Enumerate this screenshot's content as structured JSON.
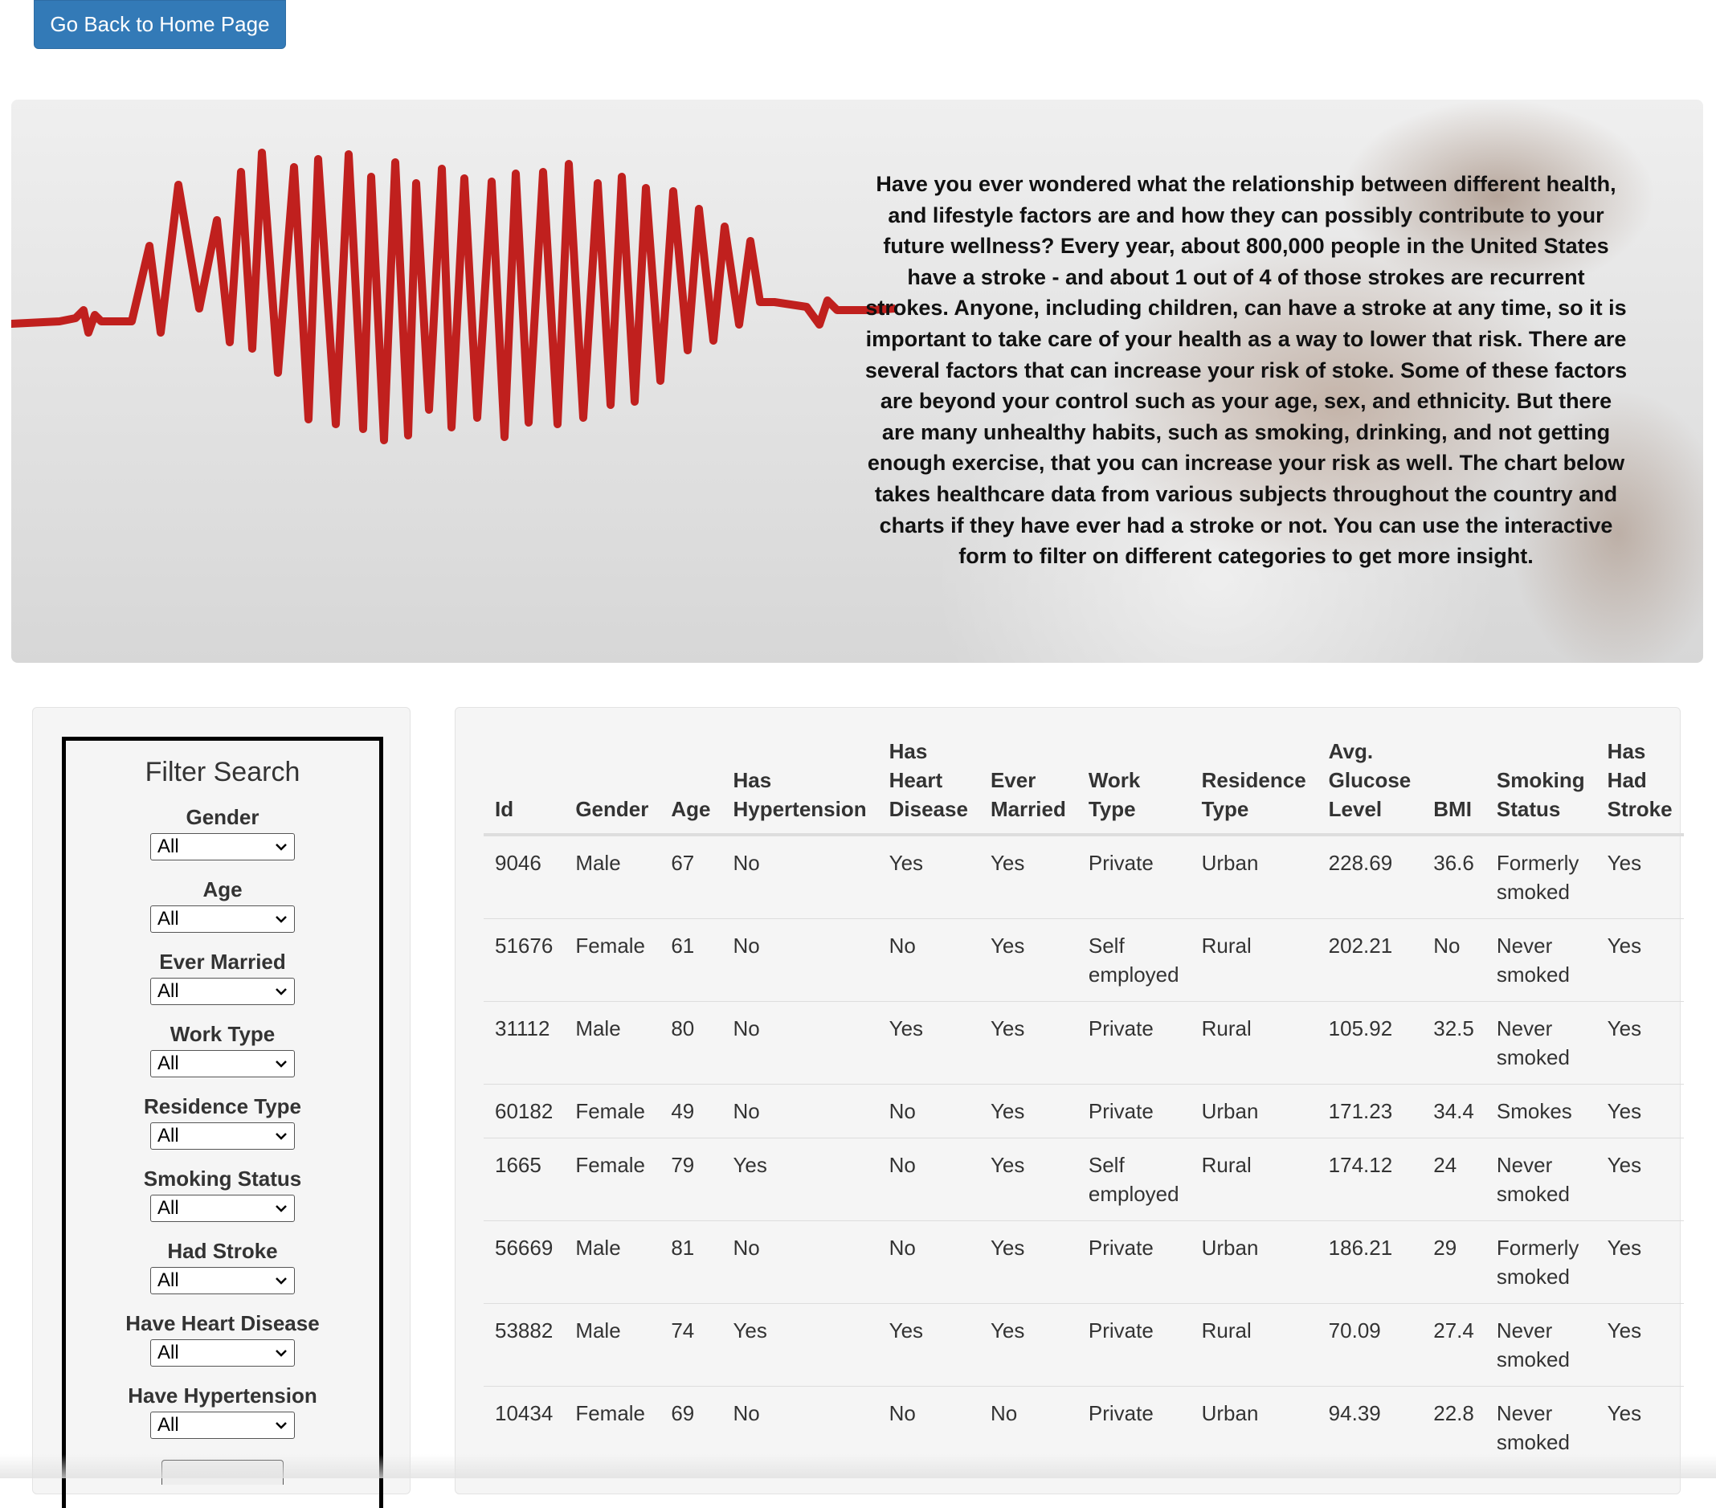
{
  "nav": {
    "home_button": "Go Back to Home Page"
  },
  "hero": {
    "text": "Have you ever wondered what the relationship between different health, and lifestyle factors are and how they can possibly contribute to your future wellness? Every year, about 800,000 people in the United States have a stroke - and about 1 out of 4 of those strokes are recurrent strokes. Anyone, including children, can have a stroke at any time, so it is important to take care of your health as a way to lower that risk. There are several factors that can increase your risk of stoke. Some of these factors are beyond your control such as your age, sex, and ethnicity. But there are many unhealthy habits, such as smoking, drinking, and not getting enough exercise, that you can increase your risk as well. The chart below takes healthcare data from various subjects throughout the country and charts if they have ever had a stroke or not. You can use the interactive form to filter on different categories to get more insight.",
    "wave_color": "#c0201e"
  },
  "filter": {
    "title": "Filter Search",
    "fields": [
      {
        "label": "Gender",
        "value": "All"
      },
      {
        "label": "Age",
        "value": "All"
      },
      {
        "label": "Ever Married",
        "value": "All"
      },
      {
        "label": "Work Type",
        "value": "All"
      },
      {
        "label": "Residence Type",
        "value": "All"
      },
      {
        "label": "Smoking Status",
        "value": "All"
      },
      {
        "label": "Had Stroke",
        "value": "All"
      },
      {
        "label": "Have Heart Disease",
        "value": "All"
      },
      {
        "label": "Have Hypertension",
        "value": "All"
      }
    ]
  },
  "table": {
    "columns": [
      [
        "Id"
      ],
      [
        "Gender"
      ],
      [
        "Age"
      ],
      [
        "Has",
        "Hypertension"
      ],
      [
        "Has",
        "Heart",
        "Disease"
      ],
      [
        "Ever",
        "Married"
      ],
      [
        "Work",
        "Type"
      ],
      [
        "Residence",
        "Type"
      ],
      [
        "Avg.",
        "Glucose",
        "Level"
      ],
      [
        "BMI"
      ],
      [
        "Smoking",
        "Status"
      ],
      [
        "Has",
        "Had",
        "Stroke"
      ]
    ],
    "rows": [
      [
        "9046",
        "Male",
        "67",
        "No",
        "Yes",
        "Yes",
        "Private",
        "Urban",
        "228.69",
        "36.6",
        "Formerly smoked",
        "Yes"
      ],
      [
        "51676",
        "Female",
        "61",
        "No",
        "No",
        "Yes",
        "Self employed",
        "Rural",
        "202.21",
        "No",
        "Never smoked",
        "Yes"
      ],
      [
        "31112",
        "Male",
        "80",
        "No",
        "Yes",
        "Yes",
        "Private",
        "Rural",
        "105.92",
        "32.5",
        "Never smoked",
        "Yes"
      ],
      [
        "60182",
        "Female",
        "49",
        "No",
        "No",
        "Yes",
        "Private",
        "Urban",
        "171.23",
        "34.4",
        "Smokes",
        "Yes"
      ],
      [
        "1665",
        "Female",
        "79",
        "Yes",
        "No",
        "Yes",
        "Self employed",
        "Rural",
        "174.12",
        "24",
        "Never smoked",
        "Yes"
      ],
      [
        "56669",
        "Male",
        "81",
        "No",
        "No",
        "Yes",
        "Private",
        "Urban",
        "186.21",
        "29",
        "Formerly smoked",
        "Yes"
      ],
      [
        "53882",
        "Male",
        "74",
        "Yes",
        "Yes",
        "Yes",
        "Private",
        "Rural",
        "70.09",
        "27.4",
        "Never smoked",
        "Yes"
      ],
      [
        "10434",
        "Female",
        "69",
        "No",
        "No",
        "No",
        "Private",
        "Urban",
        "94.39",
        "22.8",
        "Never smoked",
        "Yes"
      ]
    ]
  }
}
